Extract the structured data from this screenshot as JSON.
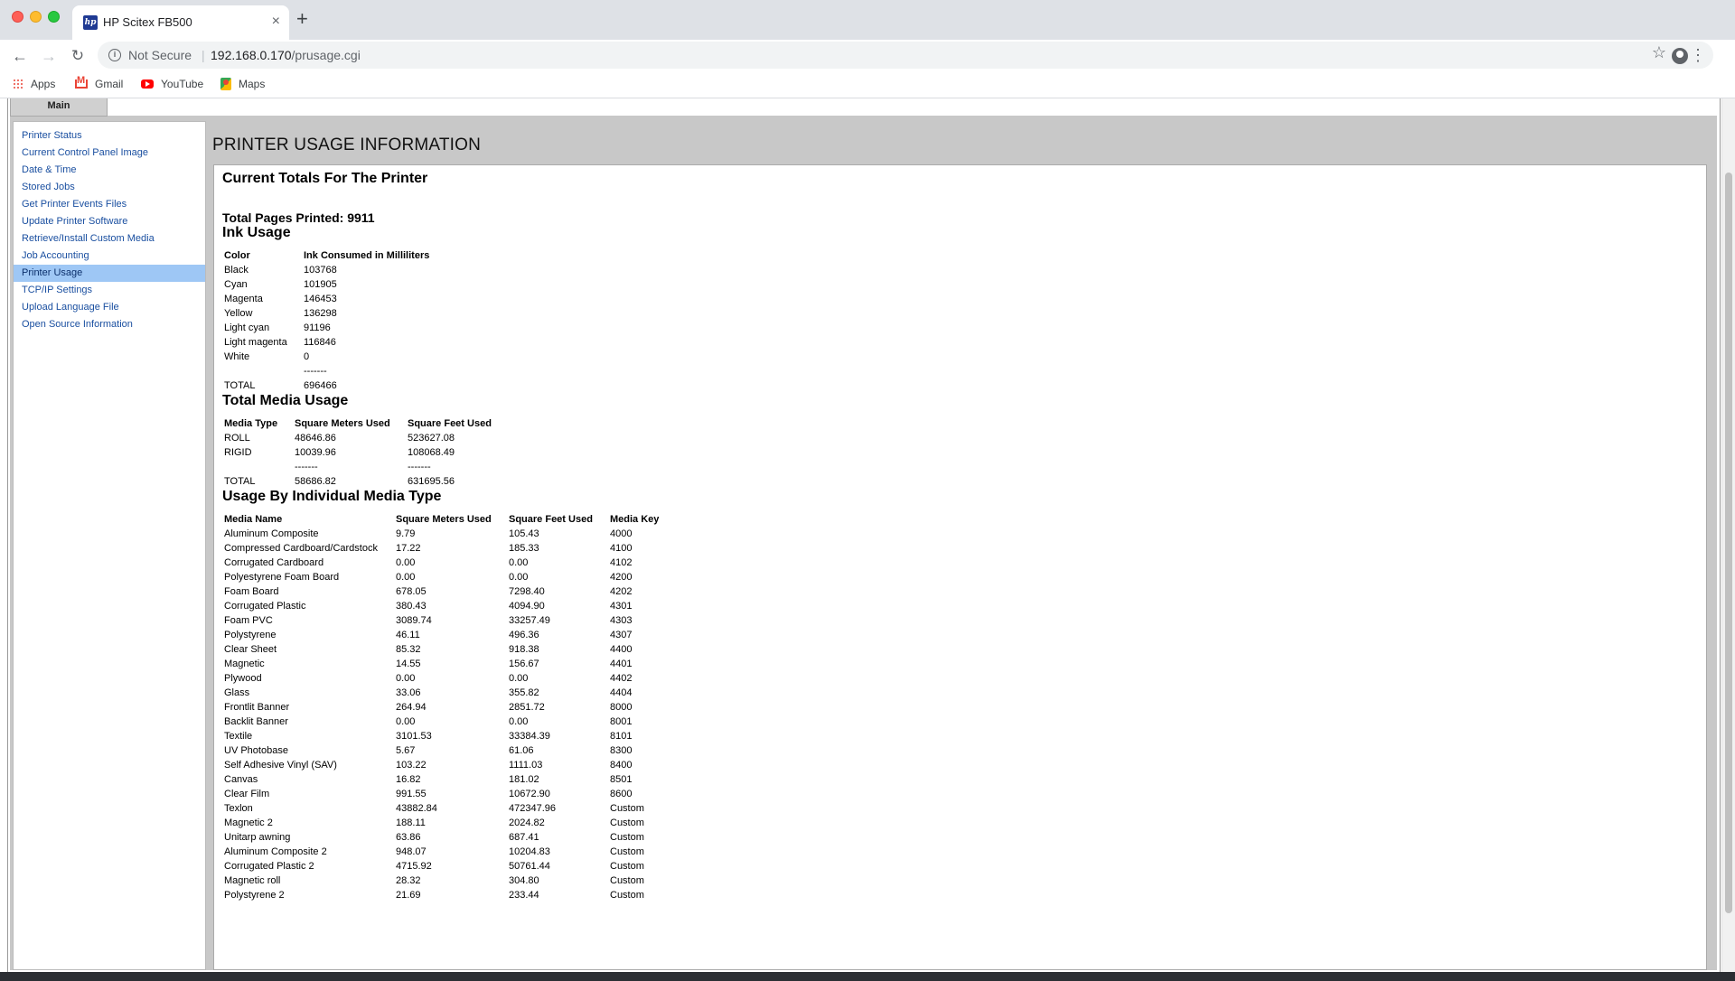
{
  "browser": {
    "tab_title": "HP Scitex FB500",
    "tab_favicon": "hp",
    "tab_close": "×",
    "new_tab": "+",
    "security_label": "Not Secure",
    "url_host": "192.168.0.170",
    "url_path": "/prusage.cgi",
    "bookmarks": [
      {
        "label": "Apps",
        "icon": "apps-icon"
      },
      {
        "label": "Gmail",
        "icon": "gmail-icon"
      },
      {
        "label": "YouTube",
        "icon": "youtube-icon"
      },
      {
        "label": "Maps",
        "icon": "maps-icon"
      }
    ]
  },
  "tab_main_label": "Main",
  "sidebar": {
    "items": [
      {
        "label": "Printer Status"
      },
      {
        "label": "Current Control Panel Image"
      },
      {
        "label": "Date & Time"
      },
      {
        "label": "Stored Jobs"
      },
      {
        "label": "Get Printer Events Files"
      },
      {
        "label": "Update Printer Software"
      },
      {
        "label": "Retrieve/Install Custom Media"
      },
      {
        "label": "Job Accounting"
      },
      {
        "label": "Printer Usage",
        "active": true
      },
      {
        "label": "TCP/IP Settings"
      },
      {
        "label": "Upload Language File"
      },
      {
        "label": "Open Source Information"
      }
    ],
    "active_color": "#9ec7f5"
  },
  "main": {
    "heading": "PRINTER USAGE INFORMATION",
    "current_totals_title": "Current Totals For The Printer",
    "total_pages_text": "Total Pages Printed: 9911",
    "ink_usage": {
      "title": "Ink Usage",
      "headers": [
        "Color",
        "Ink Consumed in Milliliters"
      ],
      "rows": [
        [
          "Black",
          "103768"
        ],
        [
          "Cyan",
          "101905"
        ],
        [
          "Magenta",
          "146453"
        ],
        [
          "Yellow",
          "136298"
        ],
        [
          "Light cyan",
          "91196"
        ],
        [
          "Light magenta",
          "116846"
        ],
        [
          "White",
          "0"
        ],
        [
          "",
          "-------"
        ],
        [
          "TOTAL",
          "696466"
        ]
      ]
    },
    "media_usage": {
      "title": "Total Media Usage",
      "headers": [
        "Media Type",
        "Square Meters Used",
        "Square Feet Used"
      ],
      "rows": [
        [
          "ROLL",
          "48646.86",
          "523627.08"
        ],
        [
          "RIGID",
          "10039.96",
          "108068.49"
        ],
        [
          "",
          "-------",
          "-------"
        ],
        [
          "TOTAL",
          "58686.82",
          "631695.56"
        ]
      ]
    },
    "individual_usage": {
      "title": "Usage By Individual Media Type",
      "headers": [
        "Media Name",
        "Square Meters Used",
        "Square Feet Used",
        "Media Key"
      ],
      "rows": [
        [
          "Aluminum Composite",
          "9.79",
          "105.43",
          "4000"
        ],
        [
          "Compressed Cardboard/Cardstock",
          "17.22",
          "185.33",
          "4100"
        ],
        [
          "Corrugated Cardboard",
          "0.00",
          "0.00",
          "4102"
        ],
        [
          "Polyestyrene Foam Board",
          "0.00",
          "0.00",
          "4200"
        ],
        [
          "Foam Board",
          "678.05",
          "7298.40",
          "4202"
        ],
        [
          "Corrugated Plastic",
          "380.43",
          "4094.90",
          "4301"
        ],
        [
          "Foam PVC",
          "3089.74",
          "33257.49",
          "4303"
        ],
        [
          "Polystyrene",
          "46.11",
          "496.36",
          "4307"
        ],
        [
          "Clear Sheet",
          "85.32",
          "918.38",
          "4400"
        ],
        [
          "Magnetic",
          "14.55",
          "156.67",
          "4401"
        ],
        [
          "Plywood",
          "0.00",
          "0.00",
          "4402"
        ],
        [
          "Glass",
          "33.06",
          "355.82",
          "4404"
        ],
        [
          "Frontlit Banner",
          "264.94",
          "2851.72",
          "8000"
        ],
        [
          "Backlit Banner",
          "0.00",
          "0.00",
          "8001"
        ],
        [
          "Textile",
          "3101.53",
          "33384.39",
          "8101"
        ],
        [
          "UV Photobase",
          "5.67",
          "61.06",
          "8300"
        ],
        [
          "Self Adhesive Vinyl (SAV)",
          "103.22",
          "1111.03",
          "8400"
        ],
        [
          "Canvas",
          "16.82",
          "181.02",
          "8501"
        ],
        [
          "Clear Film",
          "991.55",
          "10672.90",
          "8600"
        ],
        [
          "Texlon",
          "43882.84",
          "472347.96",
          "Custom"
        ],
        [
          "Magnetic 2",
          "188.11",
          "2024.82",
          "Custom"
        ],
        [
          "Unitarp awning",
          "63.86",
          "687.41",
          "Custom"
        ],
        [
          "Aluminum Composite 2",
          "948.07",
          "10204.83",
          "Custom"
        ],
        [
          "Corrugated Plastic 2",
          "4715.92",
          "50761.44",
          "Custom"
        ],
        [
          "Magnetic roll",
          "28.32",
          "304.80",
          "Custom"
        ],
        [
          "Polystyrene 2",
          "21.69",
          "233.44",
          "Custom"
        ]
      ]
    }
  }
}
